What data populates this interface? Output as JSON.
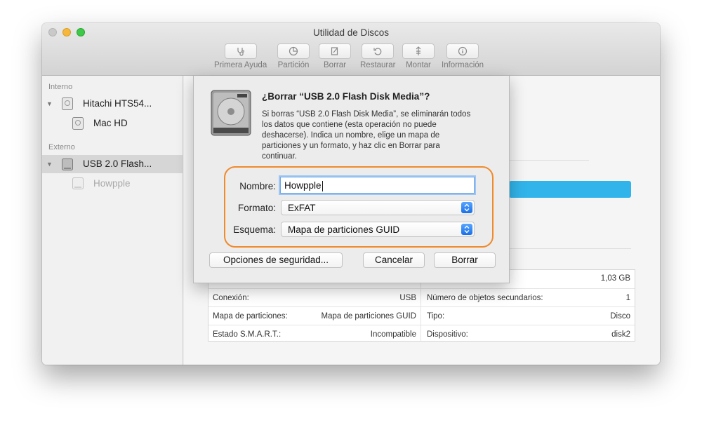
{
  "window": {
    "title": "Utilidad de Discos"
  },
  "toolbar": {
    "items": [
      {
        "label": "Primera Ayuda",
        "icon": "stethoscope-icon"
      },
      {
        "label": "Partición",
        "icon": "partition-icon"
      },
      {
        "label": "Borrar",
        "icon": "erase-icon"
      },
      {
        "label": "Restaurar",
        "icon": "restore-icon"
      },
      {
        "label": "Montar",
        "icon": "mount-icon"
      },
      {
        "label": "Información",
        "icon": "info-icon"
      }
    ]
  },
  "sidebar": {
    "section_internal": "Interno",
    "section_external": "Externo",
    "items": [
      {
        "label": "Hitachi HTS54..."
      },
      {
        "label": "Mac HD"
      },
      {
        "label": "USB 2.0 Flash..."
      },
      {
        "label": "Howpple"
      }
    ]
  },
  "dialog": {
    "title": "¿Borrar “USB 2.0 Flash Disk Media”?",
    "message_lines": [
      "Si borras “USB 2.0 Flash Disk Media”, se eliminarán todos",
      "los datos que contiene (esta operación no puede",
      "deshacerse). Indica un nombre, elige un mapa de",
      "particiones y un formato, y haz clic en Borrar para",
      "continuar."
    ],
    "name_label": "Nombre:",
    "name_value": "Howpple",
    "format_label": "Formato:",
    "format_value": "ExFAT",
    "scheme_label": "Esquema:",
    "scheme_value": "Mapa de particiones GUID",
    "security_button": "Opciones de seguridad...",
    "cancel_button": "Cancelar",
    "erase_button": "Borrar",
    "highlight_color": "#f08a2c"
  },
  "info": {
    "capacity_value": "1,03 GB",
    "rows": [
      {
        "left_label": "Conexión:",
        "left_value": "USB",
        "right_label": "Número de objetos secundarios:",
        "right_value": "1"
      },
      {
        "left_label": "Mapa de particiones:",
        "left_value": "Mapa de particiones GUID",
        "right_label": "Tipo:",
        "right_value": "Disco"
      },
      {
        "left_label": "Estado S.M.A.R.T.:",
        "left_value": "Incompatible",
        "right_label": "Dispositivo:",
        "right_value": "disk2"
      }
    ]
  },
  "colors": {
    "accent_bar": "#31b4ea",
    "selection": "#d6d6d6"
  }
}
